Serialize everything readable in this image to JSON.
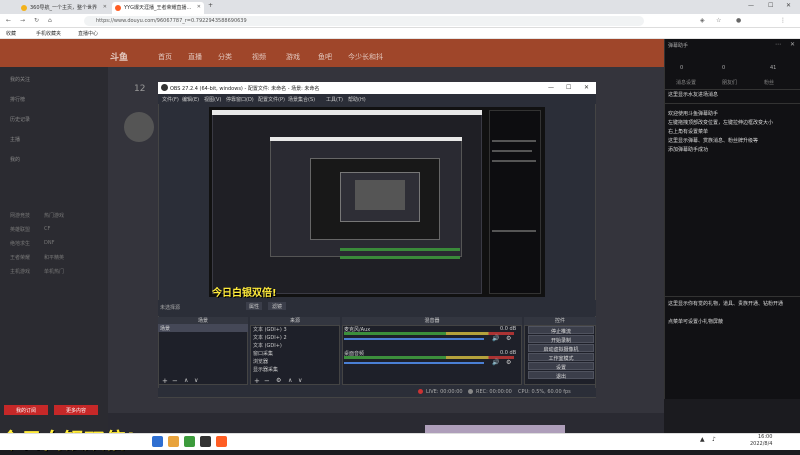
{
  "browser": {
    "tabs": [
      {
        "label": "360导航_一个主页，整个世界",
        "color": "#f3b21a"
      },
      {
        "label": "YYG爆天涯播_王者荣耀直播...",
        "color": "#ff5d23"
      }
    ],
    "new_tab": "+",
    "url": "https://www.douyu.com/96067787_r=0.7922943588690639",
    "bookmarks": [
      "收藏",
      "手机收藏夹",
      "直播中心"
    ]
  },
  "site": {
    "nav": [
      "首页",
      "直播",
      "分类",
      "视频",
      "游戏",
      "鱼吧",
      "今少长和抖"
    ],
    "logo": "斗鱼",
    "sidebar_main": [
      "我的关注",
      "排行榜",
      "历史记录",
      "主播",
      "我的"
    ],
    "sidebar_sub": [
      [
        "网游竞技",
        "热门游戏"
      ],
      [
        "英雄联盟",
        "CF"
      ],
      [
        "绝地求生",
        "DNF"
      ],
      [
        "王者荣耀",
        "和平精英"
      ],
      [
        "主机游戏",
        "单机热门"
      ]
    ],
    "buttons": [
      "我的订阅",
      "更多内容"
    ],
    "follow_count": "12"
  },
  "obs": {
    "title": "OBS 27.2.4 (64-bit, windows) - 配置文件: 未命名 - 场景: 未命名",
    "menu": [
      "文件(F)",
      "编辑(E)",
      "视图(V)",
      "停靠窗口(D)",
      "配置文件(P)",
      "场景集合(S)",
      "工具(T)",
      "帮助(H)"
    ],
    "no_source": "未选择源",
    "props": "属性",
    "filters": "滤镜",
    "docks": [
      "场景",
      "来源",
      "混音器",
      "控件"
    ],
    "scene": "场景",
    "sources": [
      "文本 (GDI+) 3",
      "文本 (GDI+) 2",
      "文本 (GDI+)",
      "窗口采集",
      "浏览器",
      "显示器采集"
    ],
    "mixer": [
      {
        "name": "麦克风/Aux",
        "db": "0.0 dB"
      },
      {
        "name": "桌面音频",
        "db": "0.0 dB"
      }
    ],
    "controls": [
      "停止推流",
      "开始录制",
      "启动虚拟摄像机",
      "工作室模式",
      "设置",
      "退出"
    ],
    "status": {
      "live": "LIVE: 00:00:00",
      "rec": "REC: 00:00:00",
      "cpu": "CPU: 0.5%, 60.00 fps"
    }
  },
  "overlay": {
    "big_text": "今日白银双倍!",
    "small_text": "今日白银双倍!"
  },
  "right_panel": {
    "header": "弹幕助手",
    "stats": [
      "0",
      "0",
      "41"
    ],
    "tabs": [
      "消息设置",
      "朋友们",
      "粉丝"
    ],
    "line1": "这里显示水友进场消息",
    "welcome": [
      "欢迎使用斗鱼弹幕助手",
      "左键拖拽顶部改变位置，左键拉伸边框改变大小",
      "右上角有设置菜单",
      "这里显示弹幕、赏族消息、粉丝牌升级等",
      "添加弹幕助手成功"
    ],
    "lower": [
      "这里显示你有觉的礼物，道具、贵族开通、钻粉开通",
      "点菜单可设置小礼物屏蔽"
    ]
  },
  "taskbar": {
    "time": "16:00",
    "date": "2022/8/4"
  },
  "colors": {
    "accent": "#ff5d23",
    "obs_bg": "#2b2e38",
    "highlight": "#ffeb3b"
  }
}
